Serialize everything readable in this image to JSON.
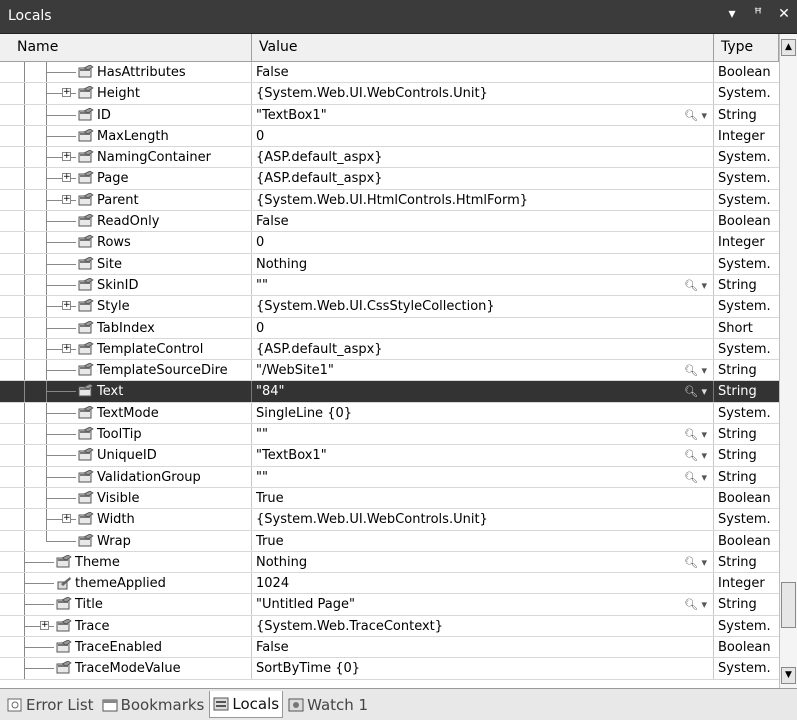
{
  "window": {
    "title": "Locals",
    "controls": {
      "dropdown": "▾",
      "pin": "ꟸ",
      "close": "✕"
    }
  },
  "header": {
    "name": "Name",
    "value": "Value",
    "type": "Type"
  },
  "rows": [
    {
      "name": "HasAttributes",
      "value": "False",
      "type": "Boolean",
      "indent": 2,
      "expandable": false,
      "search": false
    },
    {
      "name": "Height",
      "value": "{System.Web.UI.WebControls.Unit}",
      "type": "System.",
      "indent": 2,
      "expandable": true,
      "search": false
    },
    {
      "name": "ID",
      "value": "\"TextBox1\"",
      "type": "String",
      "indent": 2,
      "expandable": false,
      "search": true
    },
    {
      "name": "MaxLength",
      "value": "0",
      "type": "Integer",
      "indent": 2,
      "expandable": false,
      "search": false
    },
    {
      "name": "NamingContainer",
      "value": "{ASP.default_aspx}",
      "type": "System.",
      "indent": 2,
      "expandable": true,
      "search": false
    },
    {
      "name": "Page",
      "value": "{ASP.default_aspx}",
      "type": "System.",
      "indent": 2,
      "expandable": true,
      "search": false
    },
    {
      "name": "Parent",
      "value": "{System.Web.UI.HtmlControls.HtmlForm}",
      "type": "System.",
      "indent": 2,
      "expandable": true,
      "search": false
    },
    {
      "name": "ReadOnly",
      "value": "False",
      "type": "Boolean",
      "indent": 2,
      "expandable": false,
      "search": false
    },
    {
      "name": "Rows",
      "value": "0",
      "type": "Integer",
      "indent": 2,
      "expandable": false,
      "search": false
    },
    {
      "name": "Site",
      "value": "Nothing",
      "type": "System.",
      "indent": 2,
      "expandable": false,
      "search": false
    },
    {
      "name": "SkinID",
      "value": "\"\"",
      "type": "String",
      "indent": 2,
      "expandable": false,
      "search": true
    },
    {
      "name": "Style",
      "value": "{System.Web.UI.CssStyleCollection}",
      "type": "System.",
      "indent": 2,
      "expandable": true,
      "search": false
    },
    {
      "name": "TabIndex",
      "value": "0",
      "type": "Short",
      "indent": 2,
      "expandable": false,
      "search": false
    },
    {
      "name": "TemplateControl",
      "value": "{ASP.default_aspx}",
      "type": "System.",
      "indent": 2,
      "expandable": true,
      "search": false
    },
    {
      "name": "TemplateSourceDire",
      "value": "\"/WebSite1\"",
      "type": "String",
      "indent": 2,
      "expandable": false,
      "search": true
    },
    {
      "name": "Text",
      "value": "\"84\"",
      "type": "String",
      "indent": 2,
      "expandable": false,
      "search": true,
      "selected": true
    },
    {
      "name": "TextMode",
      "value": "SingleLine {0}",
      "type": "System.",
      "indent": 2,
      "expandable": false,
      "search": false
    },
    {
      "name": "ToolTip",
      "value": "\"\"",
      "type": "String",
      "indent": 2,
      "expandable": false,
      "search": true
    },
    {
      "name": "UniqueID",
      "value": "\"TextBox1\"",
      "type": "String",
      "indent": 2,
      "expandable": false,
      "search": true
    },
    {
      "name": "ValidationGroup",
      "value": "\"\"",
      "type": "String",
      "indent": 2,
      "expandable": false,
      "search": true
    },
    {
      "name": "Visible",
      "value": "True",
      "type": "Boolean",
      "indent": 2,
      "expandable": false,
      "search": false
    },
    {
      "name": "Width",
      "value": "{System.Web.UI.WebControls.Unit}",
      "type": "System.",
      "indent": 2,
      "expandable": true,
      "search": false
    },
    {
      "name": "Wrap",
      "value": "True",
      "type": "Boolean",
      "indent": 2,
      "expandable": false,
      "search": false,
      "last": true
    },
    {
      "name": "Theme",
      "value": "Nothing",
      "type": "String",
      "indent": 1,
      "expandable": false,
      "search": true
    },
    {
      "name": "themeApplied",
      "value": "1024",
      "type": "Integer",
      "indent": 1,
      "expandable": false,
      "search": false,
      "field": true
    },
    {
      "name": "Title",
      "value": "\"Untitled Page\"",
      "type": "String",
      "indent": 1,
      "expandable": false,
      "search": true
    },
    {
      "name": "Trace",
      "value": "{System.Web.TraceContext}",
      "type": "System.",
      "indent": 1,
      "expandable": true,
      "search": false
    },
    {
      "name": "TraceEnabled",
      "value": "False",
      "type": "Boolean",
      "indent": 1,
      "expandable": false,
      "search": false
    },
    {
      "name": "TraceModeValue",
      "value": "SortByTime {0}",
      "type": "System.",
      "indent": 1,
      "expandable": false,
      "search": false
    }
  ],
  "tabs": [
    {
      "label": "Error List",
      "icon": "error-list-icon",
      "active": false
    },
    {
      "label": "Bookmarks",
      "icon": "bookmarks-icon",
      "active": false
    },
    {
      "label": "Locals",
      "icon": "locals-icon",
      "active": true
    },
    {
      "label": "Watch 1",
      "icon": "watch-icon",
      "active": false
    }
  ],
  "search_glyph": "🔍︎ ▾"
}
